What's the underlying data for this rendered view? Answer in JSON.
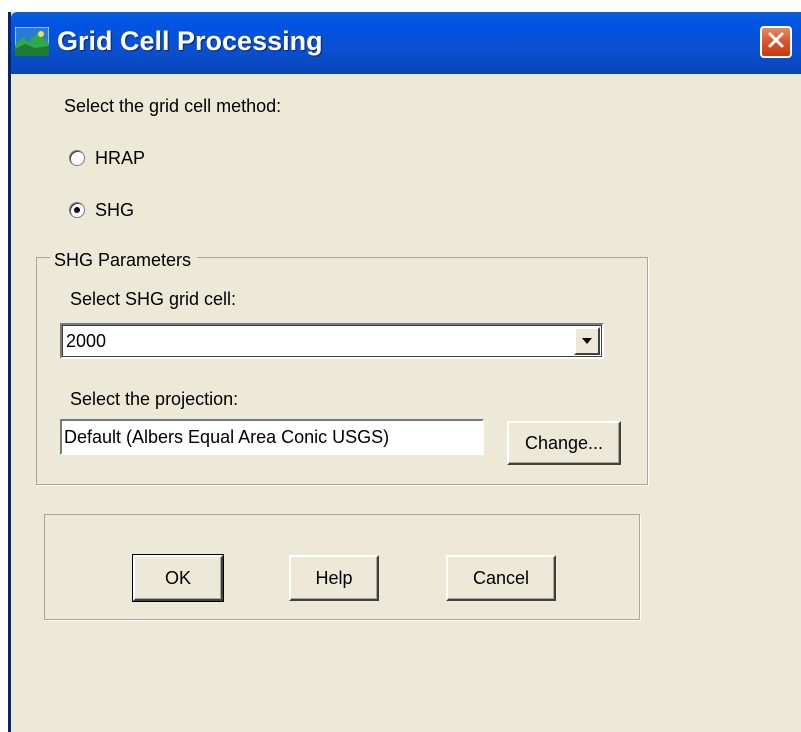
{
  "window": {
    "title": "Grid Cell Processing",
    "icon": "map-app-icon",
    "close_icon": "close-icon"
  },
  "method": {
    "prompt": "Select the grid cell method:",
    "options": [
      {
        "label": "HRAP",
        "selected": false
      },
      {
        "label": "SHG",
        "selected": true
      }
    ]
  },
  "shg_parameters": {
    "legend": "SHG Parameters",
    "grid_cell_label": "Select SHG grid cell:",
    "grid_cell_value": "2000",
    "projection_label": "Select the projection:",
    "projection_value": "Default (Albers Equal Area Conic USGS)",
    "change_button": "Change..."
  },
  "buttons": {
    "ok": "OK",
    "help": "Help",
    "cancel": "Cancel"
  },
  "colors": {
    "titlebar": "#0054e3",
    "dialog_bg": "#ece9d8",
    "close_button": "#d9542c"
  }
}
